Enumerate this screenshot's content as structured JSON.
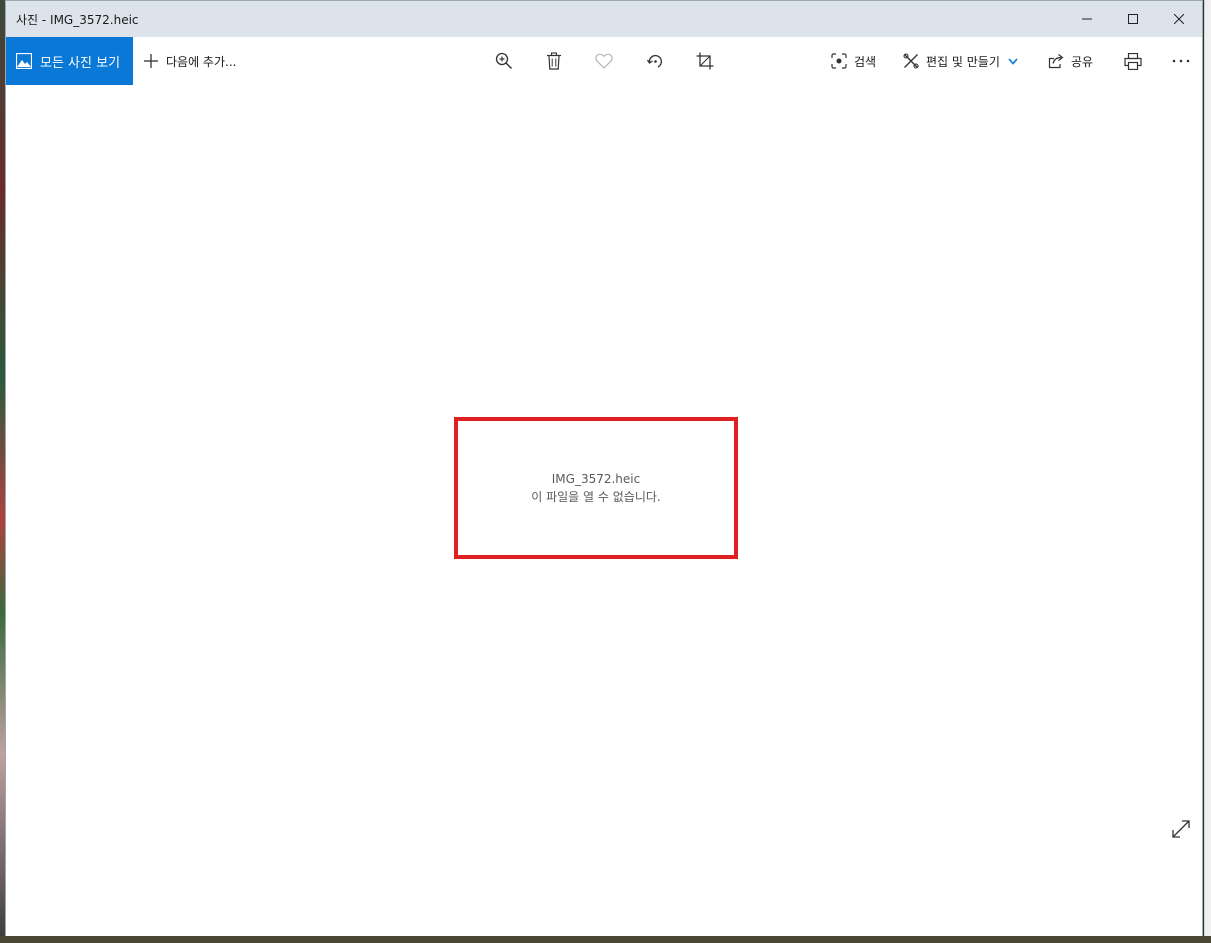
{
  "window": {
    "title": "사진 - IMG_3572.heic"
  },
  "toolbar": {
    "all_photos_label": "모든 사진 보기",
    "add_to_label": "다음에 추가...",
    "search_label": "검색",
    "edit_create_label": "편집 및 만들기",
    "share_label": "공유"
  },
  "error": {
    "filename": "IMG_3572.heic",
    "message": "이 파일을 열 수 없습니다."
  },
  "colors": {
    "accent": "#0a78d7",
    "highlight_border": "#e02020"
  }
}
